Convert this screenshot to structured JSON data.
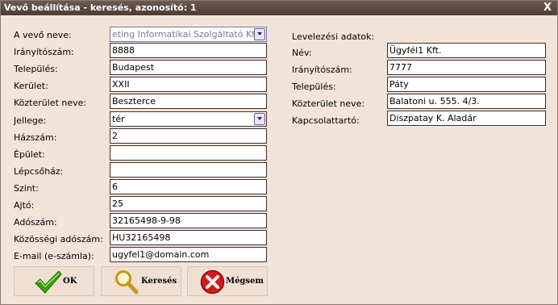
{
  "window": {
    "title": "Vevő beállítása - keresés, azonosító: 1",
    "close_glyph": "X"
  },
  "left_form": {
    "buyer_name": {
      "label": "A vevő neve:",
      "value": "eting Informatikai Szolgáltató Kft."
    },
    "postal_code": {
      "label": "Irányítószám:",
      "value": "8888"
    },
    "city": {
      "label": "Település:",
      "value": "Budapest"
    },
    "district": {
      "label": "Kerület:",
      "value": "XXII"
    },
    "street_name": {
      "label": "Közterület neve:",
      "value": "Beszterce"
    },
    "street_type": {
      "label": "Jellege:",
      "value": "tér"
    },
    "house_number": {
      "label": "Házszám:",
      "value": "2"
    },
    "building": {
      "label": "Épület:",
      "value": ""
    },
    "staircase": {
      "label": "Lépcsőház:",
      "value": ""
    },
    "floor": {
      "label": "Szint:",
      "value": "6"
    },
    "door": {
      "label": "Ajtó:",
      "value": "25"
    },
    "tax_number": {
      "label": "Adószám:",
      "value": "32165498-9-98"
    },
    "eu_tax_number": {
      "label": "Közösségi adószám:",
      "value": "HU32165498"
    },
    "email": {
      "label": "E-mail (e-számla):",
      "value": "ugyfel1@domain.com"
    }
  },
  "right_form": {
    "heading": "Levelezési adatok:",
    "name": {
      "label": "Név:",
      "value": "Ügyfél1 Kft."
    },
    "postal_code": {
      "label": "Irányítószám:",
      "value": "7777"
    },
    "city": {
      "label": "Település:",
      "value": "Páty"
    },
    "street_name": {
      "label": "Közterület neve:",
      "value": "Balatoni u. 555. 4/3."
    },
    "contact": {
      "label": "Kapcsolattartó:",
      "value": "Diszpatay K. Aladár"
    }
  },
  "buttons": {
    "ok": "OK",
    "search": "Keresés",
    "cancel": "Mégsem"
  },
  "icons": {
    "ok": "checkmark-icon",
    "search": "magnifier-icon",
    "cancel": "red-x-icon",
    "dropdown": "chevron-down-icon"
  },
  "colors": {
    "titlebar": "#5a4840",
    "background": "#f3e4d9",
    "ok_green": "#3aa010",
    "cancel_red": "#d11a1a"
  }
}
